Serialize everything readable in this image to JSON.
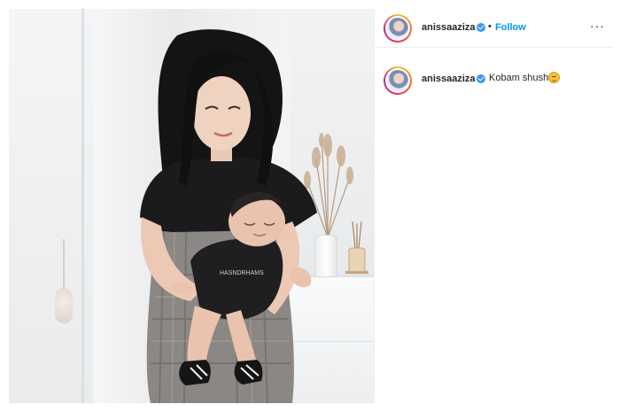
{
  "post": {
    "author": {
      "username": "anissaaziza",
      "verified": true
    },
    "follow_separator": "•",
    "follow_label": "Follow",
    "more_label": "···",
    "caption": {
      "username": "anissaaziza",
      "text": "Kobam shushu.",
      "emoji": "smiling-face-emoji"
    }
  },
  "colors": {
    "follow": "#0095f6",
    "verified": "#3897f0",
    "text": "#262626",
    "divider": "#efefef"
  },
  "icons": [
    "verified-badge-icon",
    "more-options-icon",
    "avatar-ring-icon"
  ]
}
